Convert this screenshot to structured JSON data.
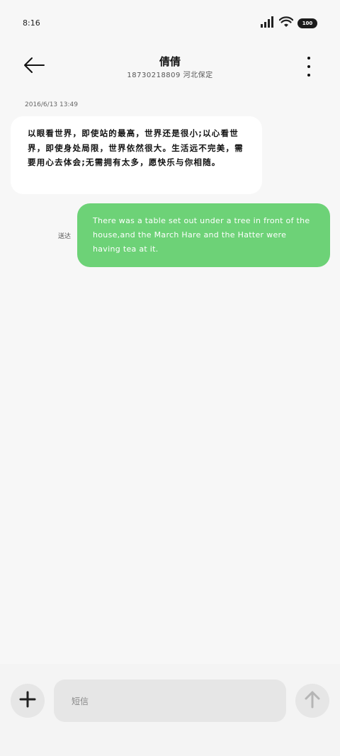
{
  "status_bar": {
    "time": "8:16",
    "battery": "100",
    "icons": [
      "signal-icon",
      "wifi-icon",
      "battery-icon"
    ]
  },
  "header": {
    "contact_name": "倩倩",
    "contact_subtitle": "18730218809 河北保定",
    "icons": [
      "back-arrow-icon",
      "more-vertical-icon"
    ]
  },
  "conversation": {
    "timestamp": "2016/6/13 13:49",
    "messages": [
      {
        "direction": "incoming",
        "text": "以眼看世界，即使站的最高，世界还是很小;以心看世界，即使身处局限，世界依然很大。生活远不完美，需要用心去体会;无需拥有太多，愿快乐与你相随。"
      },
      {
        "direction": "outgoing",
        "text": "There was a table set out under a tree in front of the house,and the March Hare and the Hatter were having tea at it.",
        "status": "送达"
      }
    ]
  },
  "composer": {
    "placeholder": "短信",
    "icons": [
      "plus-icon",
      "send-arrow-icon"
    ]
  },
  "colors": {
    "background": "#f7f7f7",
    "outgoing_bubble": "#6dd277",
    "incoming_bubble": "#ffffff",
    "input_background": "#e6e6e6"
  }
}
